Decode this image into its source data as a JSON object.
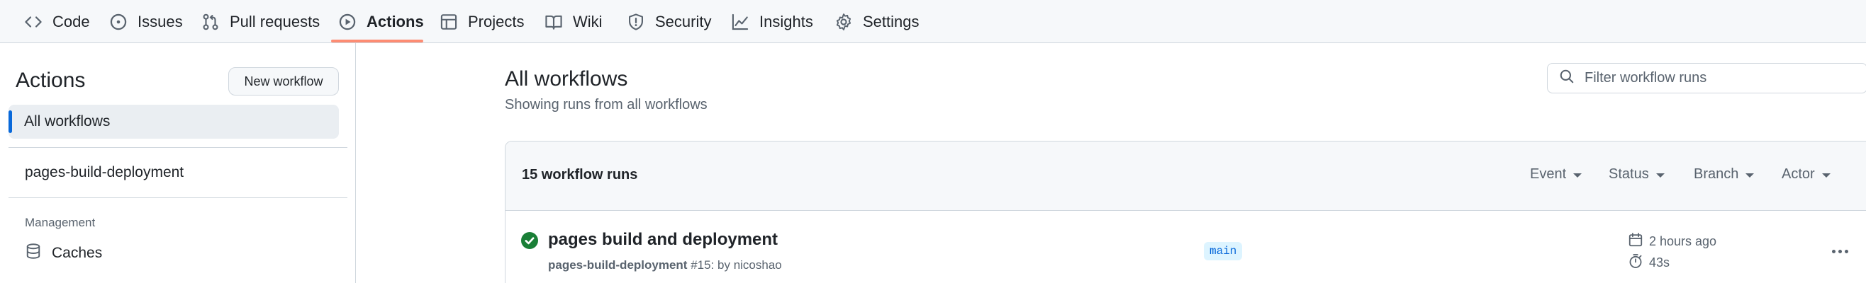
{
  "nav": {
    "tabs": [
      {
        "label": "Code",
        "icon": "code-icon"
      },
      {
        "label": "Issues",
        "icon": "issue-opened-icon"
      },
      {
        "label": "Pull requests",
        "icon": "git-pull-request-icon"
      },
      {
        "label": "Actions",
        "icon": "play-icon",
        "active": true
      },
      {
        "label": "Projects",
        "icon": "table-icon"
      },
      {
        "label": "Wiki",
        "icon": "book-icon"
      },
      {
        "label": "Security",
        "icon": "shield-icon"
      },
      {
        "label": "Insights",
        "icon": "graph-icon"
      },
      {
        "label": "Settings",
        "icon": "gear-icon"
      }
    ]
  },
  "sidebar": {
    "title": "Actions",
    "new_workflow_label": "New workflow",
    "all_workflows_label": "All workflows",
    "workflow_items": [
      "pages-build-deployment"
    ],
    "management_heading": "Management",
    "caches_label": "Caches"
  },
  "main": {
    "title": "All workflows",
    "subtitle": "Showing runs from all workflows",
    "filter_placeholder": "Filter workflow runs",
    "runs_count_label": "15 workflow runs",
    "filters": [
      "Event",
      "Status",
      "Branch",
      "Actor"
    ],
    "runs": [
      {
        "title": "pages build and deployment",
        "workflow": "pages-build-deployment",
        "run_info": "#15: by nicoshao",
        "branch": "main",
        "when": "2 hours ago",
        "duration": "43s",
        "status": "success"
      }
    ]
  },
  "colors": {
    "accent": "#0969da",
    "tab_underline": "#fd8c73",
    "success": "#1a7f37",
    "branch_bg": "#ddf4ff"
  }
}
